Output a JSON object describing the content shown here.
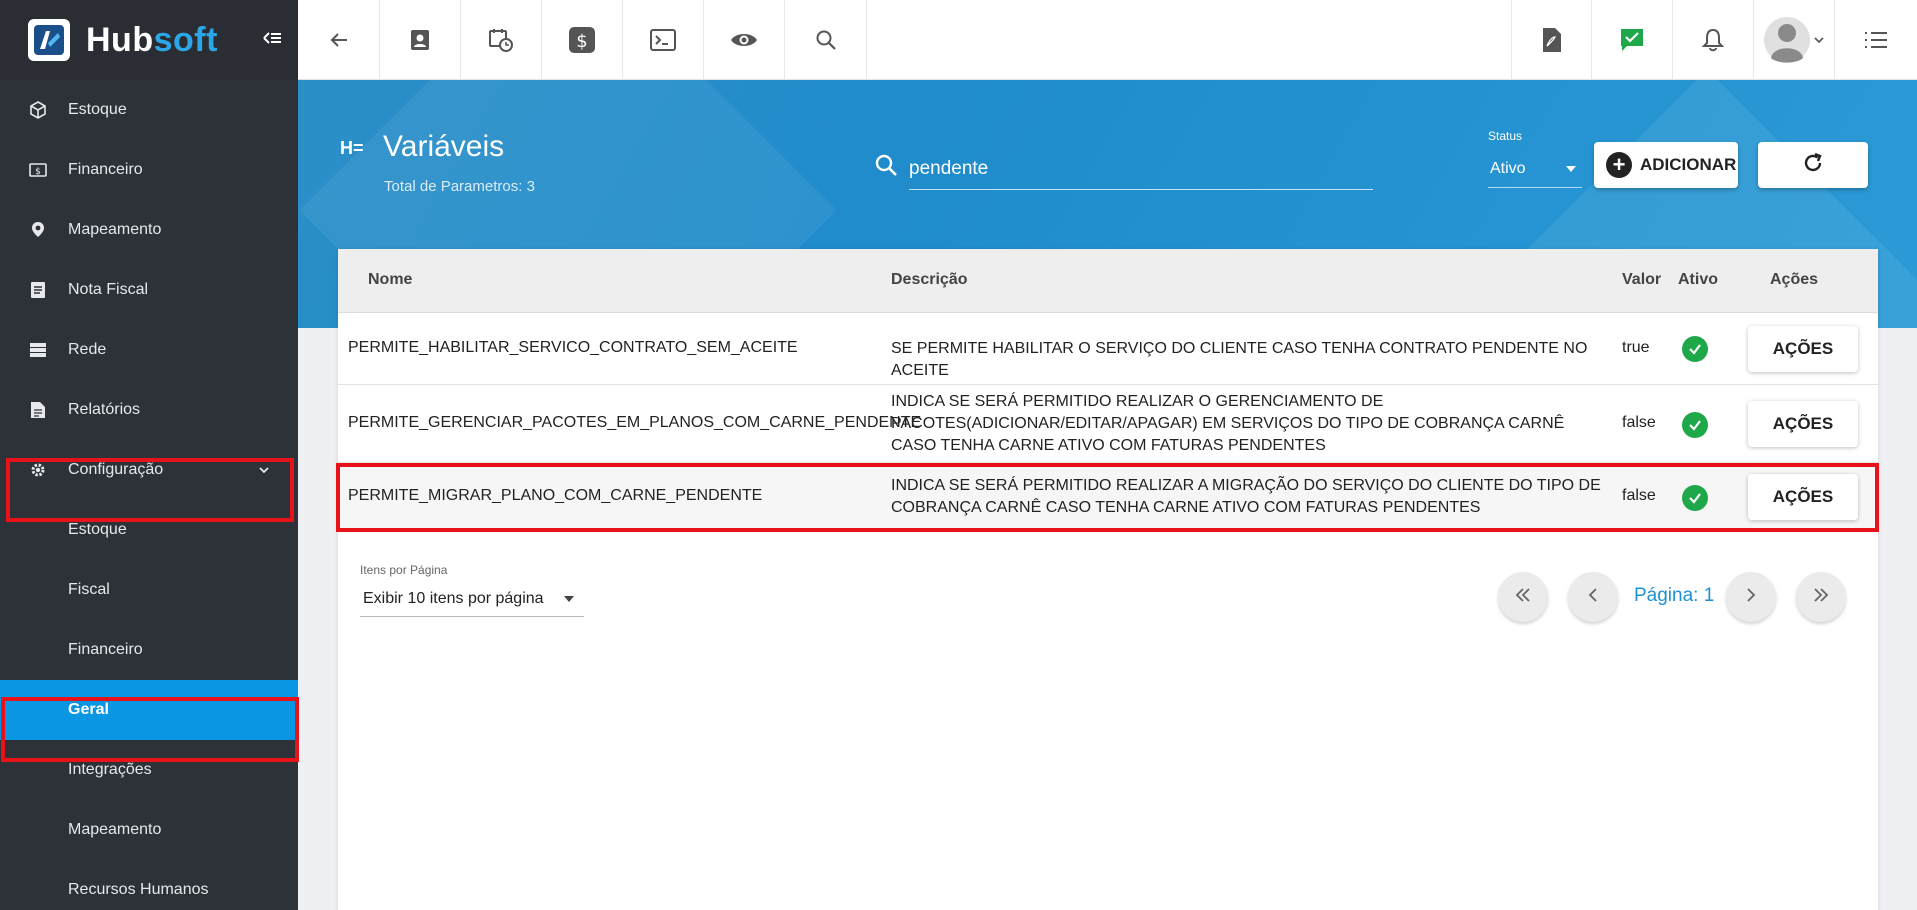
{
  "brand": {
    "hub": "Hub",
    "soft": "soft"
  },
  "sidebar": {
    "items": [
      {
        "label": "Estoque",
        "icon": "box-icon"
      },
      {
        "label": "Financeiro",
        "icon": "money-icon"
      },
      {
        "label": "Mapeamento",
        "icon": "map-pin-icon"
      },
      {
        "label": "Nota Fiscal",
        "icon": "receipt-icon"
      },
      {
        "label": "Rede",
        "icon": "server-icon"
      },
      {
        "label": "Relatórios",
        "icon": "report-icon"
      },
      {
        "label": "Configuração",
        "icon": "gear-icon"
      }
    ],
    "subitems": [
      {
        "label": "Estoque"
      },
      {
        "label": "Fiscal"
      },
      {
        "label": "Financeiro"
      },
      {
        "label": "Geral"
      },
      {
        "label": "Integrações"
      },
      {
        "label": "Mapeamento"
      },
      {
        "label": "Recursos Humanos"
      }
    ],
    "active_subitem": "Geral",
    "highlight_color": "#e8121b",
    "active_color": "#0a96e3"
  },
  "topbar": {
    "buttons": [
      "back-arrow-icon",
      "contact-card-icon",
      "calendar-clock-icon",
      "dollar-icon",
      "terminal-icon",
      "eye-icon",
      "search-icon",
      "pdf-icon",
      "check-message-icon",
      "bell-icon",
      "avatar",
      "list-menu-icon"
    ]
  },
  "header": {
    "title": "Variáveis",
    "subtitle": "Total de Parametros: 3",
    "search_value": "pendente",
    "status_label": "Status",
    "status_value": "Ativo",
    "add_label": "ADICIONAR"
  },
  "table": {
    "columns": {
      "nome": "Nome",
      "descricao": "Descrição",
      "valor": "Valor",
      "ativo": "Ativo",
      "acoes": "Ações"
    },
    "rows": [
      {
        "nome": "PERMITE_HABILITAR_SERVICO_CONTRATO_SEM_ACEITE",
        "descricao": "SE PERMITE HABILITAR O SERVIÇO DO CLIENTE CASO TENHA CONTRATO PENDENTE NO ACEITE",
        "valor": "true",
        "ativo": true,
        "acoes": "AÇÕES"
      },
      {
        "nome": "PERMITE_GERENCIAR_PACOTES_EM_PLANOS_COM_CARNE_PENDENTE",
        "descricao": "INDICA SE SERÁ PERMITIDO REALIZAR O GERENCIAMENTO DE PACOTES(ADICIONAR/EDITAR/APAGAR) EM SERVIÇOS DO TIPO DE COBRANÇA CARNÊ CASO TENHA CARNE ATIVO COM FATURAS PENDENTES",
        "valor": "false",
        "ativo": true,
        "acoes": "AÇÕES"
      },
      {
        "nome": "PERMITE_MIGRAR_PLANO_COM_CARNE_PENDENTE",
        "descricao": "INDICA SE SERÁ PERMITIDO REALIZAR A MIGRAÇÃO DO SERVIÇO DO CLIENTE DO TIPO DE COBRANÇA CARNÊ CASO TENHA CARNE ATIVO COM FATURAS PENDENTES",
        "valor": "false",
        "ativo": true,
        "acoes": "AÇÕES"
      }
    ]
  },
  "pagination": {
    "items_label": "Itens por Página",
    "items_value": "Exibir 10 itens por página",
    "page_label": "Página: 1"
  },
  "colors": {
    "accent": "#1e90d6",
    "success": "#1fa84a",
    "hero": "#2b8fc7"
  }
}
